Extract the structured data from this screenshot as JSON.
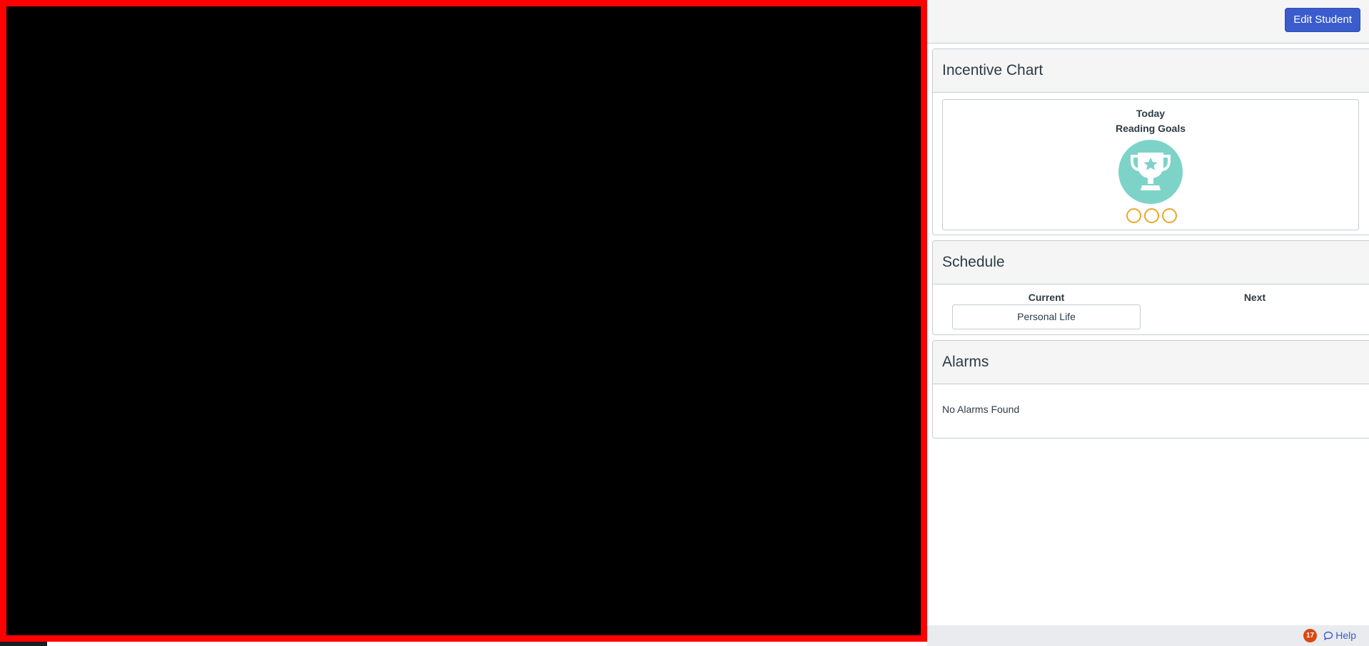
{
  "header": {
    "edit_button_label": "Edit Student"
  },
  "incentive": {
    "title": "Incentive Chart",
    "day_label": "Today",
    "goal_name": "Reading Goals",
    "icon": "trophy-icon",
    "icon_bg_color": "#7dd3c8",
    "progress_dot_color": "#e8a825",
    "progress": {
      "completed": 0,
      "total": 3
    }
  },
  "schedule": {
    "title": "Schedule",
    "current_label": "Current",
    "next_label": "Next",
    "current_item": "Personal Life"
  },
  "alarms": {
    "title": "Alarms",
    "empty_message": "No Alarms Found"
  },
  "footer": {
    "notification_count": "17",
    "help_label": "Help"
  },
  "colors": {
    "video_border": "#ff0000",
    "video_bg": "#000000",
    "accent": "#3a5ccc",
    "badge": "#d9480f"
  }
}
